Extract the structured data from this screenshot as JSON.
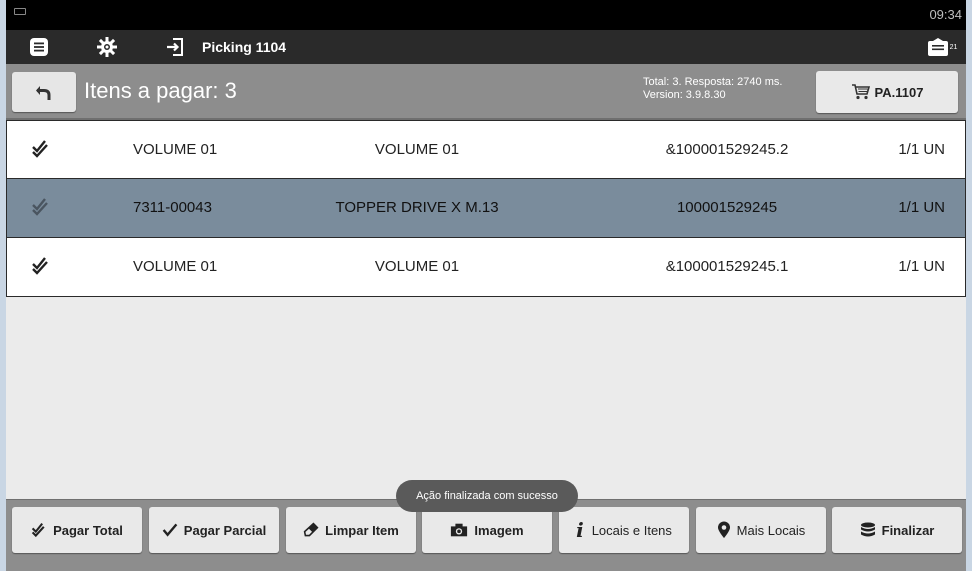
{
  "status_bar": {
    "time": "09:34"
  },
  "action_bar": {
    "title": "Picking 1104",
    "notification_count": "21"
  },
  "header": {
    "title": "Itens a pagar: 3",
    "info_line1": "Total: 3. Resposta: 2740 ms.",
    "info_line2": "Version: 3.9.8.30",
    "cart_button_label": "PA.1107"
  },
  "items": [
    {
      "code": "VOLUME 01",
      "description": "VOLUME 01",
      "barcode": "&100001529245.2",
      "qty": "1/1 UN",
      "selected": false
    },
    {
      "code": "7311-00043",
      "description": "TOPPER DRIVE X M.13",
      "barcode": "100001529245",
      "qty": "1/1 UN",
      "selected": true
    },
    {
      "code": "VOLUME 01",
      "description": "VOLUME 01",
      "barcode": "&100001529245.1",
      "qty": "1/1 UN",
      "selected": false
    }
  ],
  "toast": "Ação finalizada com sucesso",
  "bottom_buttons": {
    "pagar_total": "Pagar Total",
    "pagar_parcial": "Pagar Parcial",
    "limpar_item": "Limpar Item",
    "imagem": "Imagem",
    "locais_itens": "Locais e Itens",
    "mais_locais": "Mais Locais",
    "finalizar": "Finalizar"
  },
  "colors": {
    "selected_row": "#7a8c9c",
    "header_bg": "#8d8d8d",
    "action_bar_bg": "#2a2a2a"
  }
}
